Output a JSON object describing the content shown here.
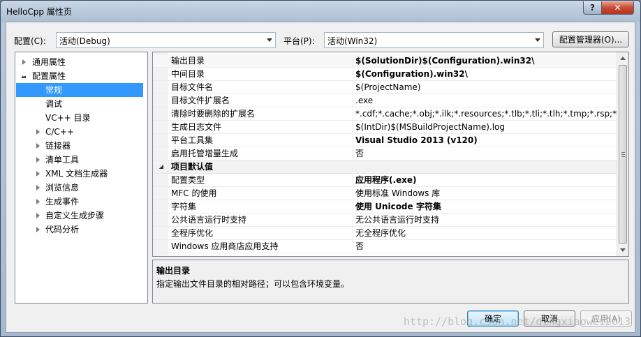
{
  "window": {
    "title": "HelloCpp 属性页",
    "help_label": "?",
    "close_label": "✕"
  },
  "toolbar": {
    "config_label": "配置(C):",
    "config_value": "活动(Debug)",
    "platform_label": "平台(P):",
    "platform_value": "活动(Win32)",
    "config_manager_label": "配置管理器(O)..."
  },
  "tree": {
    "items": [
      {
        "label": "通用属性",
        "expander": "collapsed"
      },
      {
        "label": "配置属性",
        "expander": "expanded"
      },
      {
        "label": "常规",
        "selected": true
      },
      {
        "label": "调试"
      },
      {
        "label": "VC++ 目录"
      },
      {
        "label": "C/C++",
        "expander": "collapsed"
      },
      {
        "label": "链接器",
        "expander": "collapsed"
      },
      {
        "label": "清单工具",
        "expander": "collapsed"
      },
      {
        "label": "XML 文档生成器",
        "expander": "collapsed"
      },
      {
        "label": "浏览信息",
        "expander": "collapsed"
      },
      {
        "label": "生成事件",
        "expander": "collapsed"
      },
      {
        "label": "自定义生成步骤",
        "expander": "collapsed"
      },
      {
        "label": "代码分析",
        "expander": "collapsed"
      }
    ]
  },
  "grid": {
    "general_rows": [
      {
        "name": "输出目录",
        "value": "$(SolutionDir)$(Configuration).win32\\",
        "bold": true
      },
      {
        "name": "中间目录",
        "value": "$(Configuration).win32\\",
        "bold": true
      },
      {
        "name": "目标文件名",
        "value": "$(ProjectName)"
      },
      {
        "name": "目标文件扩展名",
        "value": ".exe"
      },
      {
        "name": "清除时要删除的扩展名",
        "value": "*.cdf;*.cache;*.obj;*.ilk;*.resources;*.tlb;*.tli;*.tlh;*.tmp;*.rsp;*.pgc;*.p"
      },
      {
        "name": "生成日志文件",
        "value": "$(IntDir)$(MSBuildProjectName).log"
      },
      {
        "name": "平台工具集",
        "value": "Visual Studio 2013 (v120)",
        "bold": true
      },
      {
        "name": "启用托管增量生成",
        "value": "否"
      }
    ],
    "category": "项目默认值",
    "default_rows": [
      {
        "name": "配置类型",
        "value": "应用程序(.exe)",
        "bold": true
      },
      {
        "name": "MFC 的使用",
        "value": "使用标准 Windows 库"
      },
      {
        "name": "字符集",
        "value": "使用 Unicode 字符集",
        "bold": true
      },
      {
        "name": "公共语言运行时支持",
        "value": "无公共语言运行时支持"
      },
      {
        "name": "全程序优化",
        "value": "无全程序优化"
      },
      {
        "name": "Windows 应用商店应用支持",
        "value": "否"
      }
    ]
  },
  "description": {
    "title": "输出目录",
    "text": "指定输出文件目录的相对路径；可以包含环境变量。"
  },
  "buttons": {
    "ok": "确定",
    "cancel": "取消",
    "apply": "应用(A)"
  },
  "watermark": "http://blog.csdn.net/dingxiaowei2013"
}
